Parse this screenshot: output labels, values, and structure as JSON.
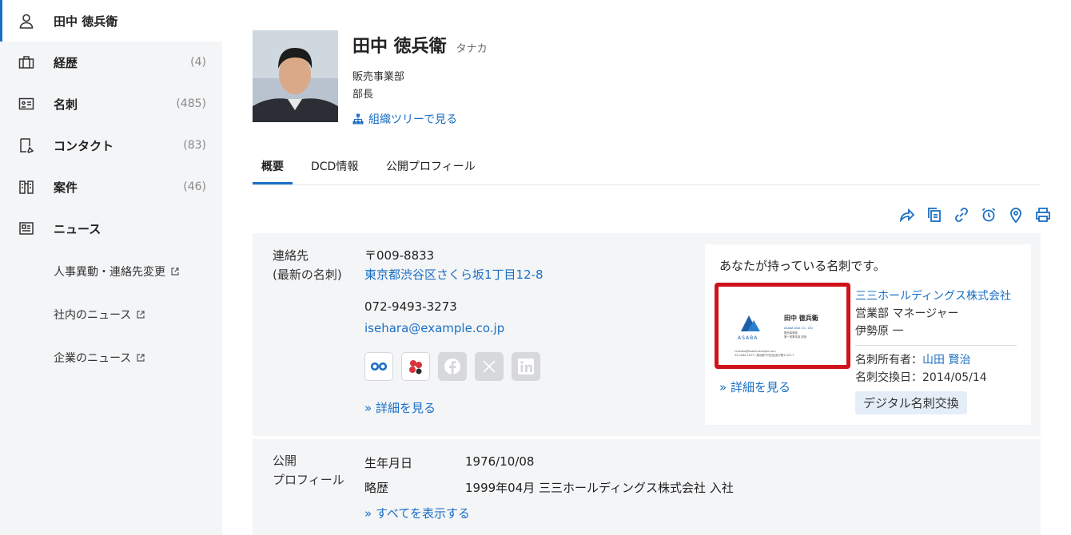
{
  "sidebar": {
    "items": [
      {
        "label": "田中 徳兵衛",
        "count": "",
        "icon": "person-icon"
      },
      {
        "label": "経歴",
        "count": "(4)",
        "icon": "briefcase-icon"
      },
      {
        "label": "名刺",
        "count": "(485)",
        "icon": "business-card-icon"
      },
      {
        "label": "コンタクト",
        "count": "(83)",
        "icon": "contact-note-icon"
      },
      {
        "label": "案件",
        "count": "(46)",
        "icon": "building-icon"
      },
      {
        "label": "ニュース",
        "count": "",
        "icon": "news-icon"
      }
    ],
    "news_links": [
      "人事異動・連絡先変更",
      "社内のニュース",
      "企業のニュース"
    ]
  },
  "profile": {
    "name": "田中 徳兵衛",
    "kana": "タナカ",
    "department": "販売事業部",
    "title": "部長",
    "org_link": "組織ツリーで見る"
  },
  "tabs": [
    "概要",
    "DCD情報",
    "公開プロフィール"
  ],
  "action_icons": [
    "share-icon",
    "copy-icon",
    "link-icon",
    "alarm-icon",
    "location-icon",
    "print-icon"
  ],
  "contact": {
    "label_line1": "連絡先",
    "label_line2": "(最新の名刺)",
    "postal": "〒009-8833",
    "address": "東京都渋谷区さくら坂1丁目12-8",
    "phone": "072-9493-3273",
    "email": "isehara@example.co.jp",
    "detail_link": "» 詳細を見る"
  },
  "card": {
    "heading": "あなたが持っている名刺です。",
    "company": "三三ホールディングス株式会社",
    "position": "営業部 マネージャー",
    "person": "伊勢原 一",
    "owner_label": "名刺所有者：",
    "owner_name": "山田 賢治",
    "exchange_date": "名刺交換日：2014/05/14",
    "badge": "デジタル名刺交換",
    "detail_link": "» 詳細を見る",
    "image_text": {
      "name": "田中 徳兵衛",
      "logo": "ASABA",
      "company_en": "ASABA ASIA CO., LTD",
      "line1": "販売事業部",
      "line2": "第一営業本部 部長",
      "email": "t.tanaka@asaba.example.com",
      "address": "03-0284-2357 / 東京都千代田区霞が関3-337-7"
    }
  },
  "public_profile": {
    "label_line1": "公開",
    "label_line2": "プロフィール",
    "birthday_label": "生年月日",
    "birthday": "1976/10/08",
    "history_label": "略歴",
    "history": "1999年04月 三三ホールディングス株式会社 入社",
    "show_all": "» すべてを表示する"
  },
  "colors": {
    "accent": "#1a6fc4",
    "sidebar_bg": "#f4f5f7",
    "highlight_border": "#d0121b"
  }
}
